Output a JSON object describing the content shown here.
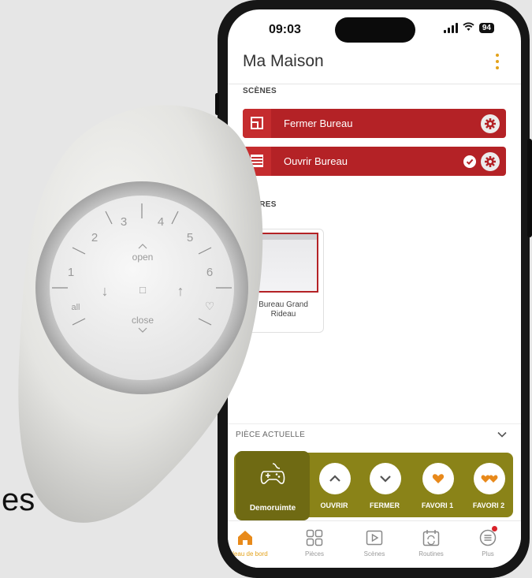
{
  "background_text": "es",
  "remote": {
    "numbers": [
      "1",
      "2",
      "3",
      "4",
      "5",
      "6"
    ],
    "all_label": "all",
    "open_label": "open",
    "close_label": "close",
    "down_arrow": "↓",
    "up_arrow": "↑",
    "stop_symbol": "□",
    "favorite_symbol": "♡"
  },
  "status_bar": {
    "time": "09:03",
    "battery": "94"
  },
  "app": {
    "title": "Ma Maison",
    "accent_color": "#e3a21a",
    "scenes_label": "SCÈNES",
    "scenes": [
      {
        "name": "Fermer Bureau",
        "icon": "window-close-icon"
      },
      {
        "name": "Ouvrir Bureau",
        "icon": "window-open-icon",
        "active": true
      }
    ],
    "scene_color": "#b42226",
    "stores_label": "STORES",
    "stores": [
      {
        "name": "Bureau Grand Rideau",
        "visible_name": "reau Grand Rideau"
      }
    ],
    "current_room_label": "PIÈCE ACTUELLE",
    "device_name": "Demoruimte",
    "controls": [
      {
        "label": "OUVRIR",
        "icon": "chevron-up-icon"
      },
      {
        "label": "FERMER",
        "icon": "chevron-down-icon"
      },
      {
        "label": "FAVORI 1",
        "icon": "heart-icon"
      },
      {
        "label": "FAVORI 2",
        "icon": "double-heart-icon"
      }
    ],
    "control_strip_color": "#8a8318",
    "tabs": [
      {
        "label": "Tableau de bord",
        "icon": "home-icon",
        "active": true
      },
      {
        "label": "Pièces",
        "icon": "rooms-grid-icon"
      },
      {
        "label": "Scènes",
        "icon": "play-icon"
      },
      {
        "label": "Routines",
        "icon": "calendar-icon"
      },
      {
        "label": "Plus",
        "icon": "menu-icon",
        "badge": true
      }
    ]
  }
}
